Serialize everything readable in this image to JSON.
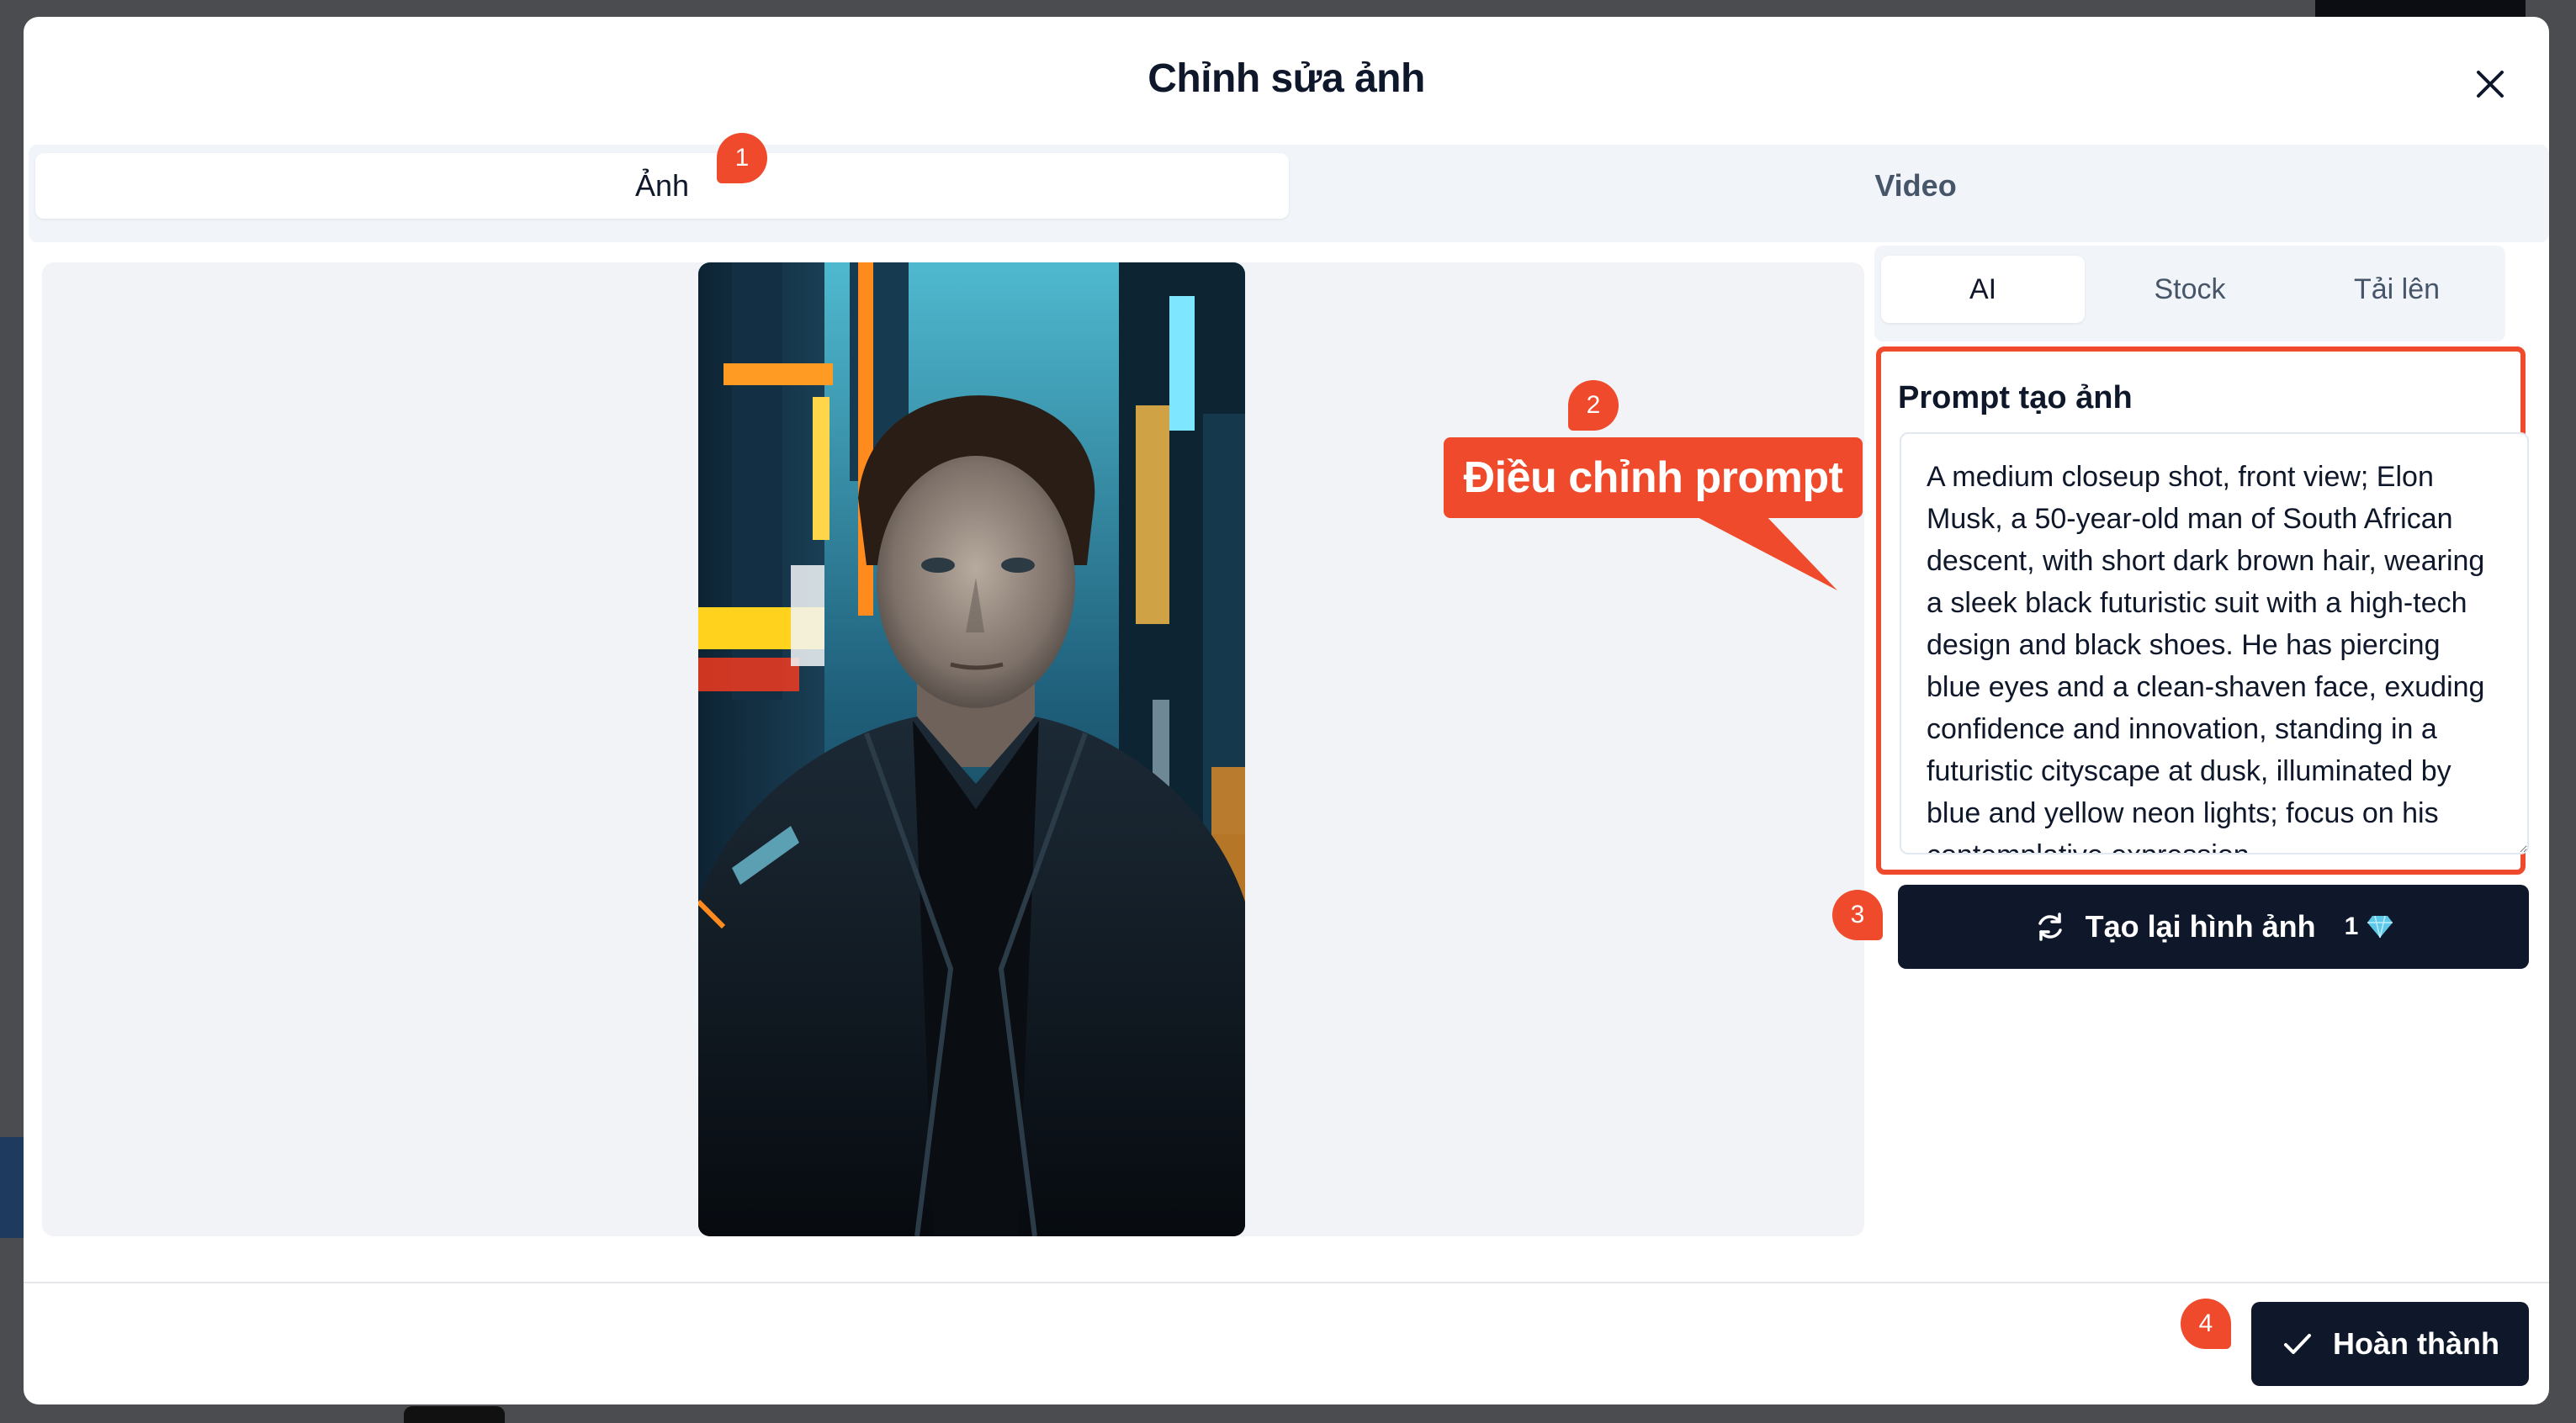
{
  "modal": {
    "title": "Chỉnh sửa ảnh",
    "close_icon": "close-icon"
  },
  "top_tabs": [
    {
      "label": "Ảnh",
      "active": true
    },
    {
      "label": "Video",
      "active": false
    }
  ],
  "sub_tabs": [
    {
      "label": "AI",
      "active": true
    },
    {
      "label": "Stock",
      "active": false
    },
    {
      "label": "Tải lên",
      "active": false
    }
  ],
  "prompt": {
    "label": "Prompt tạo ảnh",
    "value": "A medium closeup shot, front view; Elon Musk, a 50-year-old man of South African descent, with short dark brown hair, wearing a sleek black futuristic suit with a high-tech design and black shoes. He has piercing blue eyes and a clean-shaven face, exuding confidence and innovation, standing in a futuristic cityscape at dusk, illuminated by blue and yellow neon lights; focus on his contemplative expression"
  },
  "regenerate": {
    "label": "Tạo lại hình ảnh",
    "cost": "1",
    "icon": "refresh-icon",
    "cost_icon": "diamond-icon"
  },
  "done": {
    "label": "Hoàn thành",
    "icon": "check-icon"
  },
  "annotations": {
    "marker_1": "1",
    "marker_2": "2",
    "marker_3": "3",
    "marker_4": "4",
    "callout": "Điều chỉnh prompt"
  },
  "colors": {
    "accent": "#ef4a2b",
    "primary_button": "#0f172a",
    "diamond": "#5ec8e8"
  }
}
